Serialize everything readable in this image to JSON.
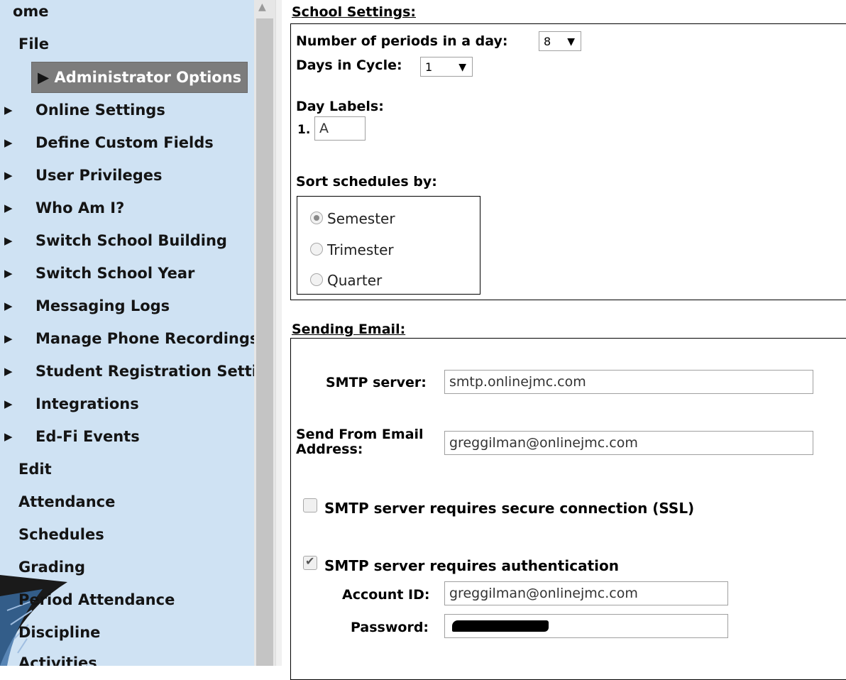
{
  "sidebar": {
    "top_items": [
      {
        "label": "ome"
      },
      {
        "label": "File"
      }
    ],
    "file_children": [
      {
        "label": "Administrator Options",
        "selected": true
      },
      {
        "label": "Online Settings"
      },
      {
        "label": "Define Custom Fields"
      },
      {
        "label": "User Privileges"
      },
      {
        "label": "Who Am I?"
      },
      {
        "label": "Switch School Building"
      },
      {
        "label": "Switch School Year"
      },
      {
        "label": "Messaging Logs"
      },
      {
        "label": "Manage Phone Recordings"
      },
      {
        "label": "Student Registration Settin"
      },
      {
        "label": "Integrations"
      },
      {
        "label": "Ed-Fi Events"
      }
    ],
    "bottom_items": [
      {
        "label": "Edit"
      },
      {
        "label": "Attendance"
      },
      {
        "label": "Schedules"
      },
      {
        "label": "Grading"
      },
      {
        "label": "Period Attendance"
      },
      {
        "label": "Discipline"
      },
      {
        "label": "Activities"
      }
    ],
    "colors": {
      "background": "#cfe2f3",
      "selected": "#7c7c7c"
    }
  },
  "school_settings": {
    "title": "School Settings:",
    "periods_label": "Number of periods in a day:",
    "periods_value": "8",
    "cycle_label": "Days in Cycle:",
    "cycle_value": "1",
    "day_labels_title": "Day Labels:",
    "day_label_index": "1.",
    "day_label_value": "A",
    "sort_title": "Sort schedules by:",
    "sort_options": [
      {
        "label": "Semester",
        "selected": true
      },
      {
        "label": "Trimester",
        "selected": false
      },
      {
        "label": "Quarter",
        "selected": false
      }
    ]
  },
  "sending_email": {
    "title": "Sending Email:",
    "smtp_label": "SMTP server:",
    "smtp_value": "smtp.onlinejmc.com",
    "from_label_line1": "Send From Email",
    "from_label_line2": "Address:",
    "from_value": "greggilman@onlinejmc.com",
    "ssl_label": "SMTP server requires secure connection (SSL)",
    "ssl_checked": false,
    "auth_label": "SMTP server requires authentication",
    "auth_checked": true,
    "account_label": "Account ID:",
    "account_value": "greggilman@onlinejmc.com",
    "password_label": "Password:"
  }
}
